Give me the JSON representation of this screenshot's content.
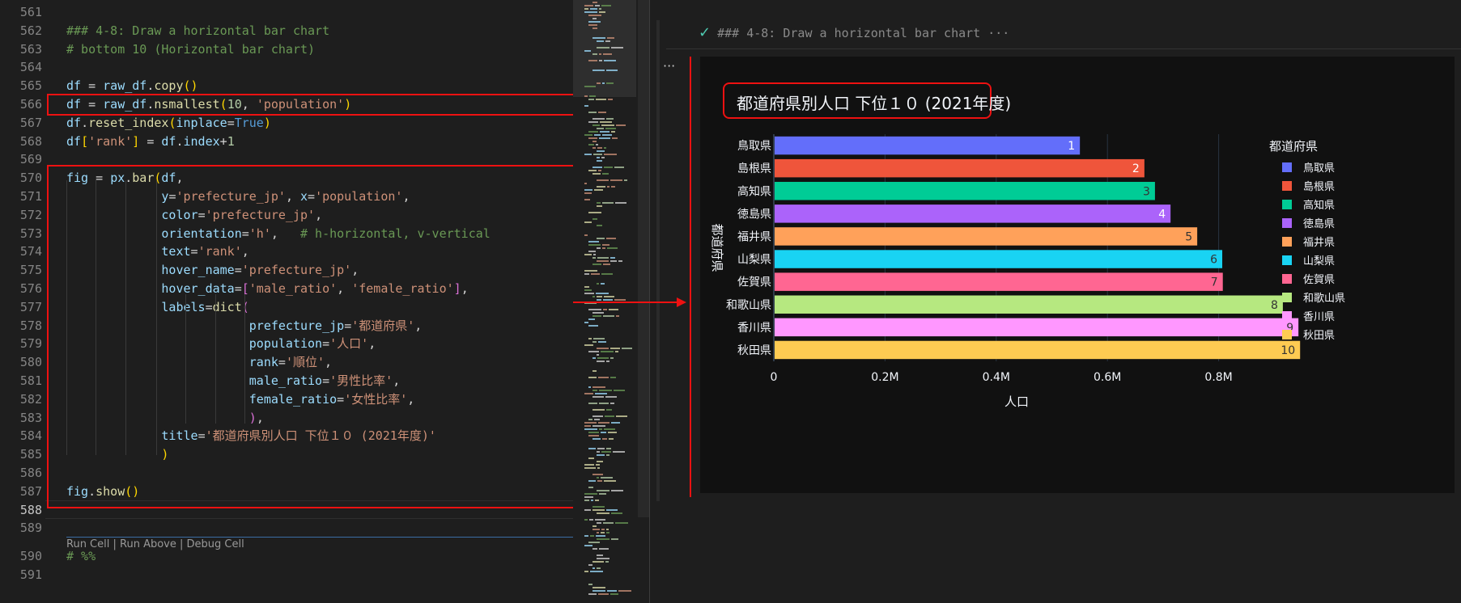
{
  "editor": {
    "lines": [
      {
        "n": "561",
        "segs": []
      },
      {
        "n": "562",
        "segs": [
          {
            "c": "c-cm",
            "t": "### 4-8: Draw a horizontal bar chart"
          }
        ]
      },
      {
        "n": "563",
        "segs": [
          {
            "c": "c-cm",
            "t": "# bottom 10 (Horizontal bar chart)"
          }
        ]
      },
      {
        "n": "564",
        "segs": []
      },
      {
        "n": "565",
        "segs": [
          {
            "c": "c-var",
            "t": "df"
          },
          {
            "c": "c-op",
            "t": " = "
          },
          {
            "c": "c-var",
            "t": "raw_df"
          },
          {
            "c": "c-op",
            "t": "."
          },
          {
            "c": "c-fn",
            "t": "copy"
          },
          {
            "c": "c-br1",
            "t": "()"
          }
        ]
      },
      {
        "n": "566",
        "segs": [
          {
            "c": "c-var",
            "t": "df"
          },
          {
            "c": "c-op",
            "t": " = "
          },
          {
            "c": "c-var",
            "t": "raw_df"
          },
          {
            "c": "c-op",
            "t": "."
          },
          {
            "c": "c-fn",
            "t": "nsmallest"
          },
          {
            "c": "c-br1",
            "t": "("
          },
          {
            "c": "c-num",
            "t": "10"
          },
          {
            "c": "c-op",
            "t": ", "
          },
          {
            "c": "c-str",
            "t": "'population'"
          },
          {
            "c": "c-br1",
            "t": ")"
          }
        ]
      },
      {
        "n": "567",
        "segs": [
          {
            "c": "c-var",
            "t": "df"
          },
          {
            "c": "c-op",
            "t": "."
          },
          {
            "c": "c-fn",
            "t": "reset_index"
          },
          {
            "c": "c-br1",
            "t": "("
          },
          {
            "c": "c-var",
            "t": "inplace"
          },
          {
            "c": "c-op",
            "t": "="
          },
          {
            "c": "c-kw",
            "t": "True"
          },
          {
            "c": "c-br1",
            "t": ")"
          }
        ]
      },
      {
        "n": "568",
        "segs": [
          {
            "c": "c-var",
            "t": "df"
          },
          {
            "c": "c-br1",
            "t": "["
          },
          {
            "c": "c-str",
            "t": "'rank'"
          },
          {
            "c": "c-br1",
            "t": "]"
          },
          {
            "c": "c-op",
            "t": " = "
          },
          {
            "c": "c-var",
            "t": "df"
          },
          {
            "c": "c-op",
            "t": "."
          },
          {
            "c": "c-var",
            "t": "index"
          },
          {
            "c": "c-op",
            "t": "+"
          },
          {
            "c": "c-num",
            "t": "1"
          }
        ]
      },
      {
        "n": "569",
        "segs": []
      },
      {
        "n": "570",
        "segs": [
          {
            "c": "c-var",
            "t": "fig"
          },
          {
            "c": "c-op",
            "t": " = "
          },
          {
            "c": "c-var",
            "t": "px"
          },
          {
            "c": "c-op",
            "t": "."
          },
          {
            "c": "c-fn",
            "t": "bar"
          },
          {
            "c": "c-br1",
            "t": "("
          },
          {
            "c": "c-var",
            "t": "df"
          },
          {
            "c": "c-op",
            "t": ","
          }
        ]
      },
      {
        "n": "571",
        "segs": [
          {
            "c": "c-op",
            "t": "             "
          },
          {
            "c": "c-var",
            "t": "y"
          },
          {
            "c": "c-op",
            "t": "="
          },
          {
            "c": "c-str",
            "t": "'prefecture_jp'"
          },
          {
            "c": "c-op",
            "t": ", "
          },
          {
            "c": "c-var",
            "t": "x"
          },
          {
            "c": "c-op",
            "t": "="
          },
          {
            "c": "c-str",
            "t": "'population'"
          },
          {
            "c": "c-op",
            "t": ","
          }
        ]
      },
      {
        "n": "572",
        "segs": [
          {
            "c": "c-op",
            "t": "             "
          },
          {
            "c": "c-var",
            "t": "color"
          },
          {
            "c": "c-op",
            "t": "="
          },
          {
            "c": "c-str",
            "t": "'prefecture_jp'"
          },
          {
            "c": "c-op",
            "t": ","
          }
        ]
      },
      {
        "n": "573",
        "segs": [
          {
            "c": "c-op",
            "t": "             "
          },
          {
            "c": "c-var",
            "t": "orientation"
          },
          {
            "c": "c-op",
            "t": "="
          },
          {
            "c": "c-str",
            "t": "'h'"
          },
          {
            "c": "c-op",
            "t": ",   "
          },
          {
            "c": "c-cm",
            "t": "# h-horizontal, v-vertical"
          }
        ]
      },
      {
        "n": "574",
        "segs": [
          {
            "c": "c-op",
            "t": "             "
          },
          {
            "c": "c-var",
            "t": "text"
          },
          {
            "c": "c-op",
            "t": "="
          },
          {
            "c": "c-str",
            "t": "'rank'"
          },
          {
            "c": "c-op",
            "t": ","
          }
        ]
      },
      {
        "n": "575",
        "segs": [
          {
            "c": "c-op",
            "t": "             "
          },
          {
            "c": "c-var",
            "t": "hover_name"
          },
          {
            "c": "c-op",
            "t": "="
          },
          {
            "c": "c-str",
            "t": "'prefecture_jp'"
          },
          {
            "c": "c-op",
            "t": ","
          }
        ]
      },
      {
        "n": "576",
        "segs": [
          {
            "c": "c-op",
            "t": "             "
          },
          {
            "c": "c-var",
            "t": "hover_data"
          },
          {
            "c": "c-op",
            "t": "="
          },
          {
            "c": "c-br2",
            "t": "["
          },
          {
            "c": "c-str",
            "t": "'male_ratio'"
          },
          {
            "c": "c-op",
            "t": ", "
          },
          {
            "c": "c-str",
            "t": "'female_ratio'"
          },
          {
            "c": "c-br2",
            "t": "]"
          },
          {
            "c": "c-op",
            "t": ","
          }
        ]
      },
      {
        "n": "577",
        "segs": [
          {
            "c": "c-op",
            "t": "             "
          },
          {
            "c": "c-var",
            "t": "labels"
          },
          {
            "c": "c-op",
            "t": "="
          },
          {
            "c": "c-fn",
            "t": "dict"
          },
          {
            "c": "c-br2",
            "t": "("
          }
        ]
      },
      {
        "n": "578",
        "segs": [
          {
            "c": "c-op",
            "t": "                         "
          },
          {
            "c": "c-var",
            "t": "prefecture_jp"
          },
          {
            "c": "c-op",
            "t": "="
          },
          {
            "c": "c-str",
            "t": "'都道府県'"
          },
          {
            "c": "c-op",
            "t": ","
          }
        ]
      },
      {
        "n": "579",
        "segs": [
          {
            "c": "c-op",
            "t": "                         "
          },
          {
            "c": "c-var",
            "t": "population"
          },
          {
            "c": "c-op",
            "t": "="
          },
          {
            "c": "c-str",
            "t": "'人口'"
          },
          {
            "c": "c-op",
            "t": ","
          }
        ]
      },
      {
        "n": "580",
        "segs": [
          {
            "c": "c-op",
            "t": "                         "
          },
          {
            "c": "c-var",
            "t": "rank"
          },
          {
            "c": "c-op",
            "t": "="
          },
          {
            "c": "c-str",
            "t": "'順位'"
          },
          {
            "c": "c-op",
            "t": ","
          }
        ]
      },
      {
        "n": "581",
        "segs": [
          {
            "c": "c-op",
            "t": "                         "
          },
          {
            "c": "c-var",
            "t": "male_ratio"
          },
          {
            "c": "c-op",
            "t": "="
          },
          {
            "c": "c-str",
            "t": "'男性比率'"
          },
          {
            "c": "c-op",
            "t": ","
          }
        ]
      },
      {
        "n": "582",
        "segs": [
          {
            "c": "c-op",
            "t": "                         "
          },
          {
            "c": "c-var",
            "t": "female_ratio"
          },
          {
            "c": "c-op",
            "t": "="
          },
          {
            "c": "c-str",
            "t": "'女性比率'"
          },
          {
            "c": "c-op",
            "t": ","
          }
        ]
      },
      {
        "n": "583",
        "segs": [
          {
            "c": "c-op",
            "t": "                         "
          },
          {
            "c": "c-br2",
            "t": ")"
          },
          {
            "c": "c-op",
            "t": ","
          }
        ]
      },
      {
        "n": "584",
        "segs": [
          {
            "c": "c-op",
            "t": "             "
          },
          {
            "c": "c-var",
            "t": "title"
          },
          {
            "c": "c-op",
            "t": "="
          },
          {
            "c": "c-str",
            "t": "'都道府県別人口 下位１０ (2021年度)'"
          }
        ]
      },
      {
        "n": "585",
        "segs": [
          {
            "c": "c-op",
            "t": "             "
          },
          {
            "c": "c-br1",
            "t": ")"
          }
        ]
      },
      {
        "n": "586",
        "segs": []
      },
      {
        "n": "587",
        "segs": [
          {
            "c": "c-var",
            "t": "fig"
          },
          {
            "c": "c-op",
            "t": "."
          },
          {
            "c": "c-fn",
            "t": "show"
          },
          {
            "c": "c-br1",
            "t": "()"
          }
        ]
      },
      {
        "n": "588",
        "segs": [],
        "active": true
      },
      {
        "n": "589",
        "segs": []
      },
      {
        "n": "590",
        "segs": [
          {
            "c": "c-cm",
            "t": "# %%"
          }
        ]
      },
      {
        "n": "591",
        "segs": []
      }
    ],
    "codelens": "Run Cell | Run Above | Debug Cell"
  },
  "output": {
    "cell_header": "### 4-8: Draw a horizontal bar chart ···",
    "more_label": "···"
  },
  "chart_data": {
    "type": "bar",
    "orientation": "horizontal",
    "title": "都道府県別人口 下位１０ (2021年度)",
    "xlabel": "人口",
    "ylabel": "都道府県",
    "legend_title": "都道府県",
    "xlim": [
      0,
      1000000
    ],
    "xticks": [
      {
        "v": 0,
        "label": "0"
      },
      {
        "v": 200000,
        "label": "0.2M"
      },
      {
        "v": 400000,
        "label": "0.4M"
      },
      {
        "v": 600000,
        "label": "0.6M"
      },
      {
        "v": 800000,
        "label": "0.8M"
      }
    ],
    "legend_position": "right",
    "grid": true,
    "background": "#111111",
    "bars": [
      {
        "category": "鳥取県",
        "value": 549000,
        "label": "1",
        "color": "#636efa"
      },
      {
        "category": "島根県",
        "value": 665000,
        "label": "2",
        "color": "#ef553b"
      },
      {
        "category": "高知県",
        "value": 684000,
        "label": "3",
        "color": "#00cc96"
      },
      {
        "category": "徳島県",
        "value": 712000,
        "label": "4",
        "color": "#ab63fa"
      },
      {
        "category": "福井県",
        "value": 760000,
        "label": "5",
        "color": "#ffa15a"
      },
      {
        "category": "山梨県",
        "value": 805000,
        "label": "6",
        "color": "#19d3f3"
      },
      {
        "category": "佐賀県",
        "value": 806000,
        "label": "7",
        "color": "#ff6692"
      },
      {
        "category": "和歌山県",
        "value": 914000,
        "label": "8",
        "color": "#b6e880"
      },
      {
        "category": "香川県",
        "value": 942000,
        "label": "9",
        "color": "#ff97ff"
      },
      {
        "category": "秋田県",
        "value": 945000,
        "label": "10",
        "color": "#fecb52"
      }
    ]
  }
}
